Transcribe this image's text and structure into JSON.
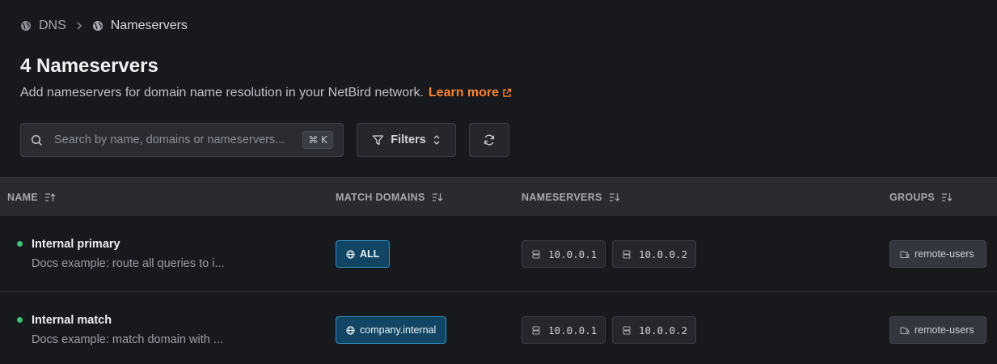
{
  "breadcrumb": {
    "root": "DNS",
    "current": "Nameservers"
  },
  "header": {
    "title": "4 Nameservers",
    "subtitle": "Add nameservers for domain name resolution in your NetBird network.",
    "learn_more": "Learn more"
  },
  "toolbar": {
    "search_placeholder": "Search by name, domains or nameservers...",
    "shortcut": "⌘ K",
    "filters_label": "Filters"
  },
  "table": {
    "columns": {
      "name": "NAME",
      "match_domains": "MATCH DOMAINS",
      "nameservers": "NAMESERVERS",
      "groups": "GROUPS"
    },
    "rows": [
      {
        "name": "Internal primary",
        "description": "Docs example: route all queries to i...",
        "match_domain": "ALL",
        "nameservers": [
          "10.0.0.1",
          "10.0.0.2"
        ],
        "group": "remote-users"
      },
      {
        "name": "Internal match",
        "description": "Docs example: match domain with ...",
        "match_domain": "company.internal",
        "nameservers": [
          "10.0.0.1",
          "10.0.0.2"
        ],
        "group": "remote-users"
      }
    ]
  },
  "colors": {
    "background": "#18191d",
    "accent": "#f68330",
    "status_active": "#3fc27a",
    "domain_pill": "#124563"
  }
}
